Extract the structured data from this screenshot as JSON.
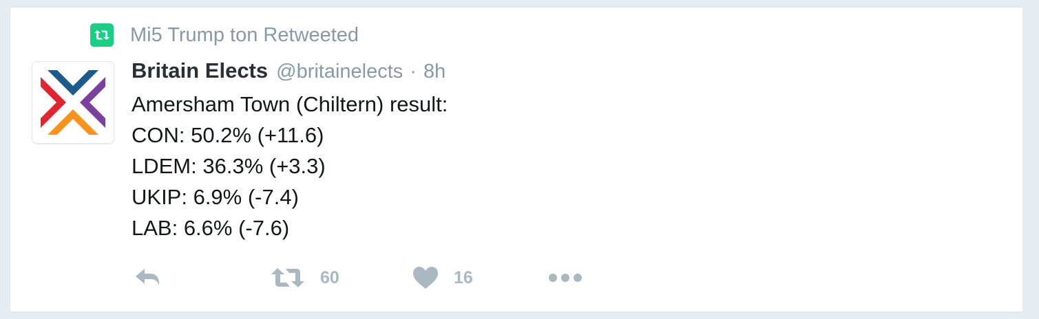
{
  "retweet_context": {
    "text": "Mi5 Trump ton Retweeted",
    "icon": "retweet-icon",
    "badge_color": "#19cf86"
  },
  "author": {
    "display_name": "Britain Elects",
    "handle": "@britainelects",
    "separator": "·",
    "time": "8h",
    "avatar": "britain-elects-logo"
  },
  "tweet": {
    "lines": [
      "Amersham Town (Chiltern) result:",
      "CON: 50.2% (+11.6)",
      "LDEM: 36.3% (+3.3)",
      "UKIP: 6.9% (-7.4)",
      "LAB: 6.6% (-7.6)"
    ]
  },
  "actions": {
    "reply": {
      "icon": "reply-icon"
    },
    "retweet": {
      "icon": "retweet-icon",
      "count": "60"
    },
    "like": {
      "icon": "heart-icon",
      "count": "16"
    },
    "more": {
      "icon": "more-dots-icon"
    }
  },
  "colors": {
    "action_gray": "#aab8c2",
    "meta_gray": "#8899a6",
    "logo_blue": "#1c5a8c",
    "logo_red": "#e0262f",
    "logo_orange": "#f7941d",
    "logo_purple": "#7b3f9e"
  }
}
